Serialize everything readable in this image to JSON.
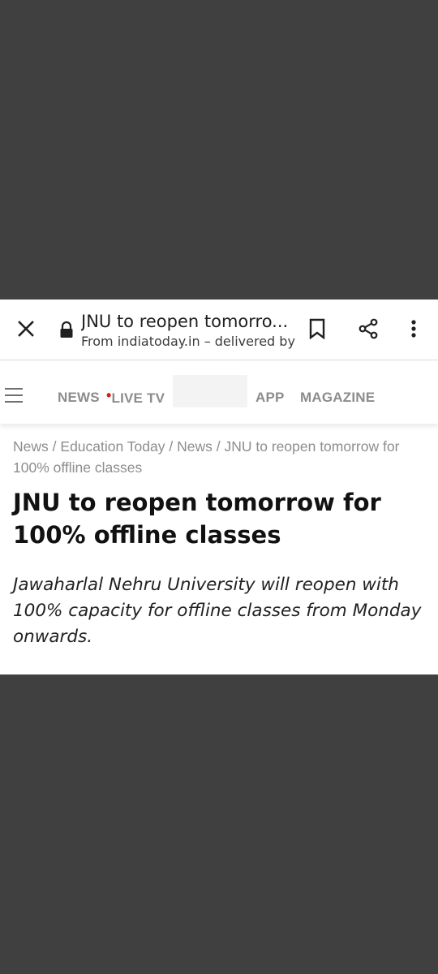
{
  "custom_tab": {
    "title": "JNU to reopen tomorro...",
    "subtitle": "From indiatoday.in – delivered by",
    "icons": {
      "close": "close-icon",
      "lock": "lock-icon",
      "bookmark": "bookmark-icon",
      "share": "share-icon",
      "more": "more-vert-icon"
    }
  },
  "site_nav": {
    "items": [
      {
        "label": "NEWS"
      },
      {
        "label": "LIVE TV",
        "dot": "•"
      },
      {
        "label": "APP"
      },
      {
        "label": "MAGAZINE"
      }
    ]
  },
  "article": {
    "breadcrumb": {
      "items": [
        "News",
        "Education Today",
        "News",
        "JNU to reopen tomorrow for 100% offline classes"
      ],
      "separator": "/"
    },
    "headline": "JNU to reopen tomorrow for 100% offline classes",
    "summary": "Jawaharlal Nehru University will reopen with 100% capacity for offline classes from Monday onwards."
  },
  "colors": {
    "backdrop": "#404040",
    "nav_text": "#8c8c8c",
    "live_dot": "#d21f1f",
    "breadcrumb": "#8d8d8d"
  }
}
